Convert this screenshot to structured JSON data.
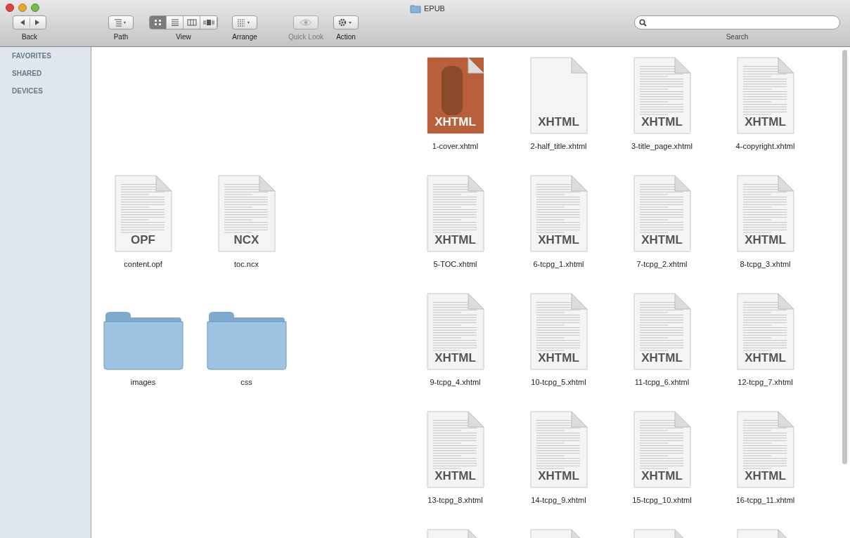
{
  "window": {
    "title": "EPUB"
  },
  "toolbar": {
    "groups": [
      {
        "kind": "nav",
        "label": "Back"
      },
      {
        "kind": "path",
        "label": "Path"
      },
      {
        "kind": "view",
        "label": "View",
        "segments": [
          {
            "selected": true
          },
          {
            "selected": false
          },
          {
            "selected": false
          },
          {
            "selected": false
          }
        ]
      },
      {
        "kind": "arrange",
        "label": "Arrange"
      },
      {
        "kind": "quicklook",
        "label": "Quick Look",
        "disabled": true
      },
      {
        "kind": "action",
        "label": "Action"
      }
    ],
    "search": {
      "label": "Search"
    }
  },
  "sidebar": {
    "sections": [
      "FAVORITES",
      "SHARED",
      "DEVICES"
    ]
  },
  "left_items": [
    {
      "kind": "document",
      "badge": "OPF",
      "name": "content.opf"
    },
    {
      "kind": "document",
      "badge": "NCX",
      "name": "toc.ncx"
    },
    {
      "kind": "folder",
      "name": "images"
    },
    {
      "kind": "folder",
      "name": "css"
    }
  ],
  "right_items": [
    {
      "kind": "cover",
      "badge": "XHTML",
      "name": "1-cover.xhtml"
    },
    {
      "kind": "blank",
      "badge": "XHTML",
      "name": "2-half_title.xhtml"
    },
    {
      "kind": "document",
      "badge": "XHTML",
      "name": "3-title_page.xhtml"
    },
    {
      "kind": "document",
      "badge": "XHTML",
      "name": "4-copyright.xhtml"
    },
    {
      "kind": "document",
      "badge": "XHTML",
      "name": "5-TOC.xhtml"
    },
    {
      "kind": "document",
      "badge": "XHTML",
      "name": "6-tcpg_1.xhtml"
    },
    {
      "kind": "document",
      "badge": "XHTML",
      "name": "7-tcpg_2.xhtml"
    },
    {
      "kind": "document",
      "badge": "XHTML",
      "name": "8-tcpg_3.xhtml"
    },
    {
      "kind": "document",
      "badge": "XHTML",
      "name": "9-tcpg_4.xhtml"
    },
    {
      "kind": "document",
      "badge": "XHTML",
      "name": "10-tcpg_5.xhtml"
    },
    {
      "kind": "document",
      "badge": "XHTML",
      "name": "11-tcpg_6.xhtml"
    },
    {
      "kind": "document",
      "badge": "XHTML",
      "name": "12-tcpg_7.xhtml"
    },
    {
      "kind": "document",
      "badge": "XHTML",
      "name": "13-tcpg_8.xhtml"
    },
    {
      "kind": "document",
      "badge": "XHTML",
      "name": "14-tcpg_9.xhtml"
    },
    {
      "kind": "document",
      "badge": "XHTML",
      "name": "15-tcpg_10.xhtml"
    },
    {
      "kind": "document",
      "badge": "XHTML",
      "name": "16-tcpg_11.xhtml"
    },
    {
      "kind": "document"
    },
    {
      "kind": "document"
    },
    {
      "kind": "document"
    },
    {
      "kind": "document"
    }
  ]
}
